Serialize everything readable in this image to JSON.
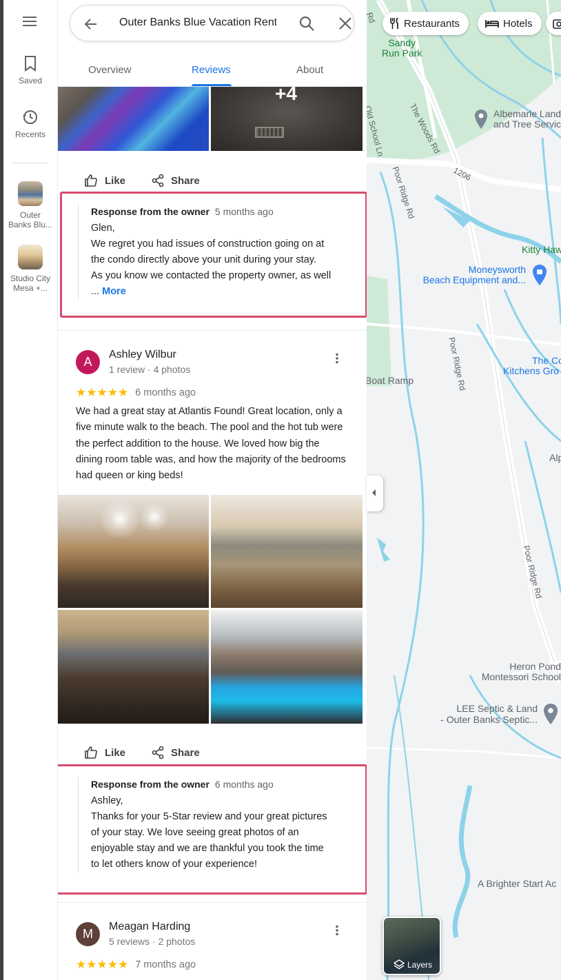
{
  "rail": {
    "menu_icon": "menu-icon",
    "saved_label": "Saved",
    "recents_label": "Recents",
    "recent_places": [
      {
        "label_line1": "Outer",
        "label_line2": "Banks Blu..."
      },
      {
        "label_line1": "Studio City",
        "label_line2": "Mesa +..."
      }
    ]
  },
  "search": {
    "query": "Outer Banks Blue Vacation Rentals"
  },
  "tabs": [
    {
      "label": "Overview"
    },
    {
      "label": "Reviews"
    },
    {
      "label": "About"
    }
  ],
  "top_review": {
    "photo_more_count": "+4",
    "like_label": "Like",
    "share_label": "Share",
    "owner_response": {
      "title": "Response from the owner",
      "date": "5 months ago",
      "lines": [
        "Glen,",
        "We regret you had issues of construction going on at",
        "the condo directly above your unit during your stay.",
        "As you know we contacted the property owner, as well"
      ],
      "ellipsis": "...",
      "more_label": "More"
    }
  },
  "review_ashley": {
    "avatar_letter": "A",
    "name": "Ashley Wilbur",
    "meta": "1 review · 4 photos",
    "stars": "★★★★★",
    "rating": 5,
    "date": "6 months ago",
    "text": "We had a great stay at Atlantis Found! Great location, only a five minute walk to the beach. The pool and the hot tub were the perfect addition to the house. We loved how big the dining room table was, and how the majority of the bedrooms had queen or king beds!",
    "like_label": "Like",
    "share_label": "Share",
    "owner_response": {
      "title": "Response from the owner",
      "date": "6 months ago",
      "lines": [
        "Ashley,",
        "Thanks for your 5-Star review and your great pictures",
        "of your stay.  We love seeing great photos of an",
        "enjoyable stay and we are thankful you took the time",
        "to let others know of your experience!"
      ]
    }
  },
  "review_meagan": {
    "avatar_letter": "M",
    "name": "Meagan Harding",
    "meta": "5 reviews · 2 photos",
    "stars": "★★★★★",
    "rating": 5,
    "date": "7 months ago"
  },
  "map": {
    "chips": [
      {
        "label": "Restaurants",
        "icon": "fork-knife-icon"
      },
      {
        "label": "Hotels",
        "icon": "bed-icon"
      }
    ],
    "places": {
      "sandy_run_park_1": "Sandy",
      "sandy_run_park_2": "Run Park",
      "albemarle_1": "Albemarle Land",
      "albemarle_2": "and Tree Servic",
      "kitty_hawk": "Kitty Haw",
      "moneysworth_1": "Moneysworth",
      "moneysworth_2": "Beach Equipment and...",
      "the_co_1": "The Co",
      "the_co_2": "Kitchens Gro",
      "boat_ramp": "Boat Ramp",
      "alp": "Alp",
      "heron_pond_1": "Heron Pond",
      "heron_pond_2": "Montessori School",
      "lee_septic_1": "LEE Septic & Land",
      "lee_septic_2": "- Outer Banks Septic...",
      "brighter_start": "A Brighter Start Ac"
    },
    "roads": {
      "the_woods_rd": "The Woods Rd",
      "old_school_ln": "Old School Ln",
      "poor_ridge_rd_1": "Poor Ridge Rd",
      "poor_ridge_rd_2": "Poor Ridge Rd",
      "poor_ridge_rd_3": "Poor Ridge Rd",
      "route_1206": "1206",
      "rd_top": "Rd"
    },
    "layers_label": "Layers"
  }
}
